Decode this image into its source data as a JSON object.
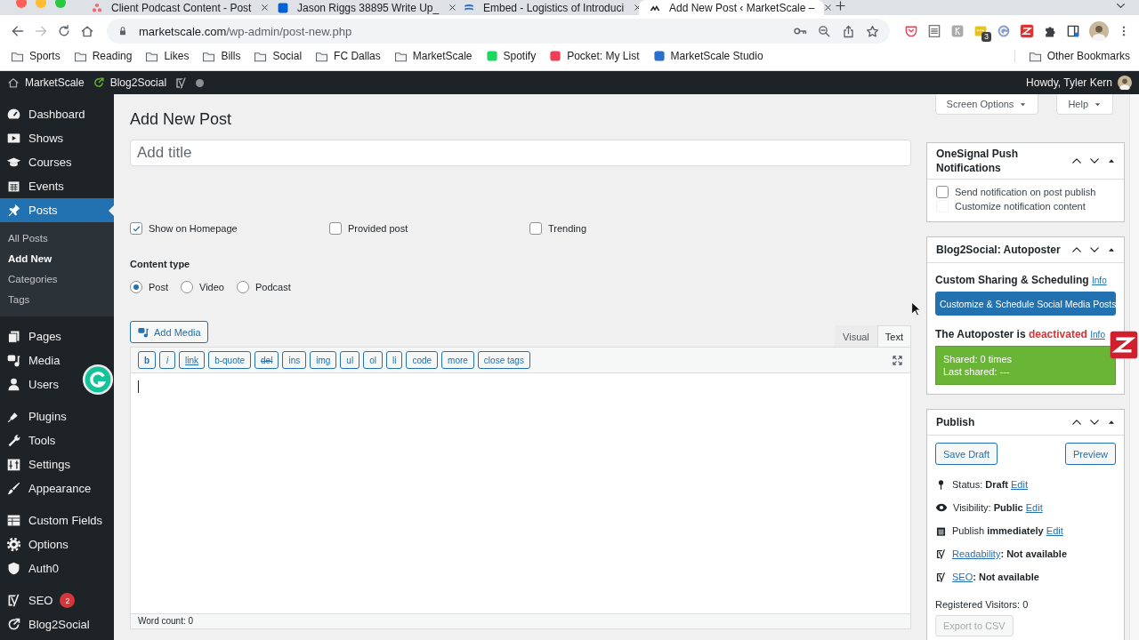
{
  "browser": {
    "tabs": [
      {
        "title": "Client Podcast Content - Post",
        "selected": false
      },
      {
        "title": "Jason Riggs 38895 Write Up_",
        "selected": false
      },
      {
        "title": "Embed - Logistics of Introduci",
        "selected": false
      },
      {
        "title": "Add New Post ‹ MarketScale –",
        "selected": true
      }
    ],
    "url": {
      "domain": "marketscale.com",
      "path": "/wp-admin/post-new.php"
    },
    "extension_badge": "3",
    "bookmarks": [
      {
        "label": "Sports",
        "kind": "folder"
      },
      {
        "label": "Reading",
        "kind": "folder"
      },
      {
        "label": "Likes",
        "kind": "folder"
      },
      {
        "label": "Bills",
        "kind": "folder"
      },
      {
        "label": "Social",
        "kind": "folder"
      },
      {
        "label": "FC Dallas",
        "kind": "folder"
      },
      {
        "label": "MarketScale",
        "kind": "folder"
      },
      {
        "label": "Spotify",
        "kind": "app",
        "color": "#1ed760"
      },
      {
        "label": "Pocket: My List",
        "kind": "app",
        "color": "#ef3f56"
      },
      {
        "label": "MarketScale Studio",
        "kind": "app",
        "color": "#2a6fc9"
      }
    ],
    "other_bookmarks": "Other Bookmarks"
  },
  "admin_bar": {
    "items": [
      "MarketScale",
      "Blog2Social"
    ],
    "greeting": "Howdy, Tyler Kern"
  },
  "sidebar": {
    "groups": [
      [
        {
          "label": "Dashboard",
          "selected": false
        },
        {
          "label": "Shows",
          "selected": false
        },
        {
          "label": "Courses",
          "selected": false
        },
        {
          "label": "Events",
          "selected": false
        },
        {
          "label": "Posts",
          "selected": true,
          "children": [
            {
              "label": "All Posts",
              "selected": false
            },
            {
              "label": "Add New",
              "selected": true
            },
            {
              "label": "Categories",
              "selected": false
            },
            {
              "label": "Tags",
              "selected": false
            }
          ]
        }
      ],
      [
        {
          "label": "Pages",
          "selected": false
        },
        {
          "label": "Media",
          "selected": false
        },
        {
          "label": "Users",
          "selected": false
        }
      ],
      [
        {
          "label": "Plugins",
          "selected": false
        },
        {
          "label": "Tools",
          "selected": false
        },
        {
          "label": "Settings",
          "selected": false
        },
        {
          "label": "Appearance",
          "selected": false
        }
      ],
      [
        {
          "label": "Custom Fields",
          "selected": false
        },
        {
          "label": "Options",
          "selected": false
        },
        {
          "label": "Auth0",
          "selected": false
        }
      ],
      [
        {
          "label": "SEO",
          "selected": false,
          "badge": "2"
        },
        {
          "label": "Blog2Social",
          "selected": false
        }
      ]
    ]
  },
  "screen_meta": {
    "screen_options": "Screen Options",
    "help": "Help"
  },
  "editor": {
    "heading": "Add New Post",
    "title_placeholder": "Add title",
    "options": [
      {
        "label": "Show on Homepage",
        "checked": true
      },
      {
        "label": "Provided post",
        "checked": false
      },
      {
        "label": "Trending",
        "checked": false
      }
    ],
    "content_type": {
      "label": "Content type",
      "choices": [
        {
          "label": "Post",
          "selected": true
        },
        {
          "label": "Video",
          "selected": false
        },
        {
          "label": "Podcast",
          "selected": false
        }
      ]
    },
    "add_media": "Add Media",
    "modes": [
      {
        "label": "Visual",
        "selected": false
      },
      {
        "label": "Text",
        "selected": true
      }
    ],
    "quicktags": [
      {
        "label": "b",
        "kind": "bold"
      },
      {
        "label": "i",
        "kind": "italic"
      },
      {
        "label": "link",
        "kind": "underline"
      },
      {
        "label": "b-quote",
        "kind": "plain"
      },
      {
        "label": "del",
        "kind": "strike"
      },
      {
        "label": "ins",
        "kind": "plain"
      },
      {
        "label": "img",
        "kind": "plain"
      },
      {
        "label": "ul",
        "kind": "plain"
      },
      {
        "label": "ol",
        "kind": "plain"
      },
      {
        "label": "li",
        "kind": "plain"
      },
      {
        "label": "code",
        "kind": "plain"
      },
      {
        "label": "more",
        "kind": "plain"
      },
      {
        "label": "close tags",
        "kind": "plain"
      }
    ],
    "word_count": "Word count: 0"
  },
  "onesignal": {
    "title": "OneSignal Push Notifications",
    "options": [
      {
        "label": "Send notification on post publish",
        "checked": false,
        "disabled": false
      },
      {
        "label": "Customize notification content",
        "checked": false,
        "disabled": true
      }
    ]
  },
  "blog2social": {
    "title": "Blog2Social: Autoposter",
    "heading": "Custom Sharing & Scheduling",
    "heading_link": "Info",
    "button": "Customize & Schedule Social Media Posts",
    "status": "The Autoposter is",
    "status_value": "deactivated",
    "status_link": "Info",
    "stats": [
      "Shared: 0 times",
      "Last shared: ---"
    ]
  },
  "publish": {
    "title": "Publish",
    "save_draft": "Save Draft",
    "preview": "Preview",
    "rows": [
      {
        "kind": "status",
        "label": "Status:",
        "value": "Draft",
        "link": "Edit"
      },
      {
        "kind": "visibility",
        "label": "Visibility:",
        "value": "Public",
        "link": "Edit"
      },
      {
        "kind": "schedule",
        "label": "Publish",
        "value": "immediately",
        "link": "Edit"
      },
      {
        "kind": "yoast",
        "link": "Readability",
        "value": ": Not available"
      },
      {
        "kind": "yoast",
        "link": "SEO",
        "value": ": Not available"
      }
    ],
    "visitors": "Registered Visitors: 0",
    "export": {
      "label": "Export to CSV",
      "disabled": true
    }
  }
}
